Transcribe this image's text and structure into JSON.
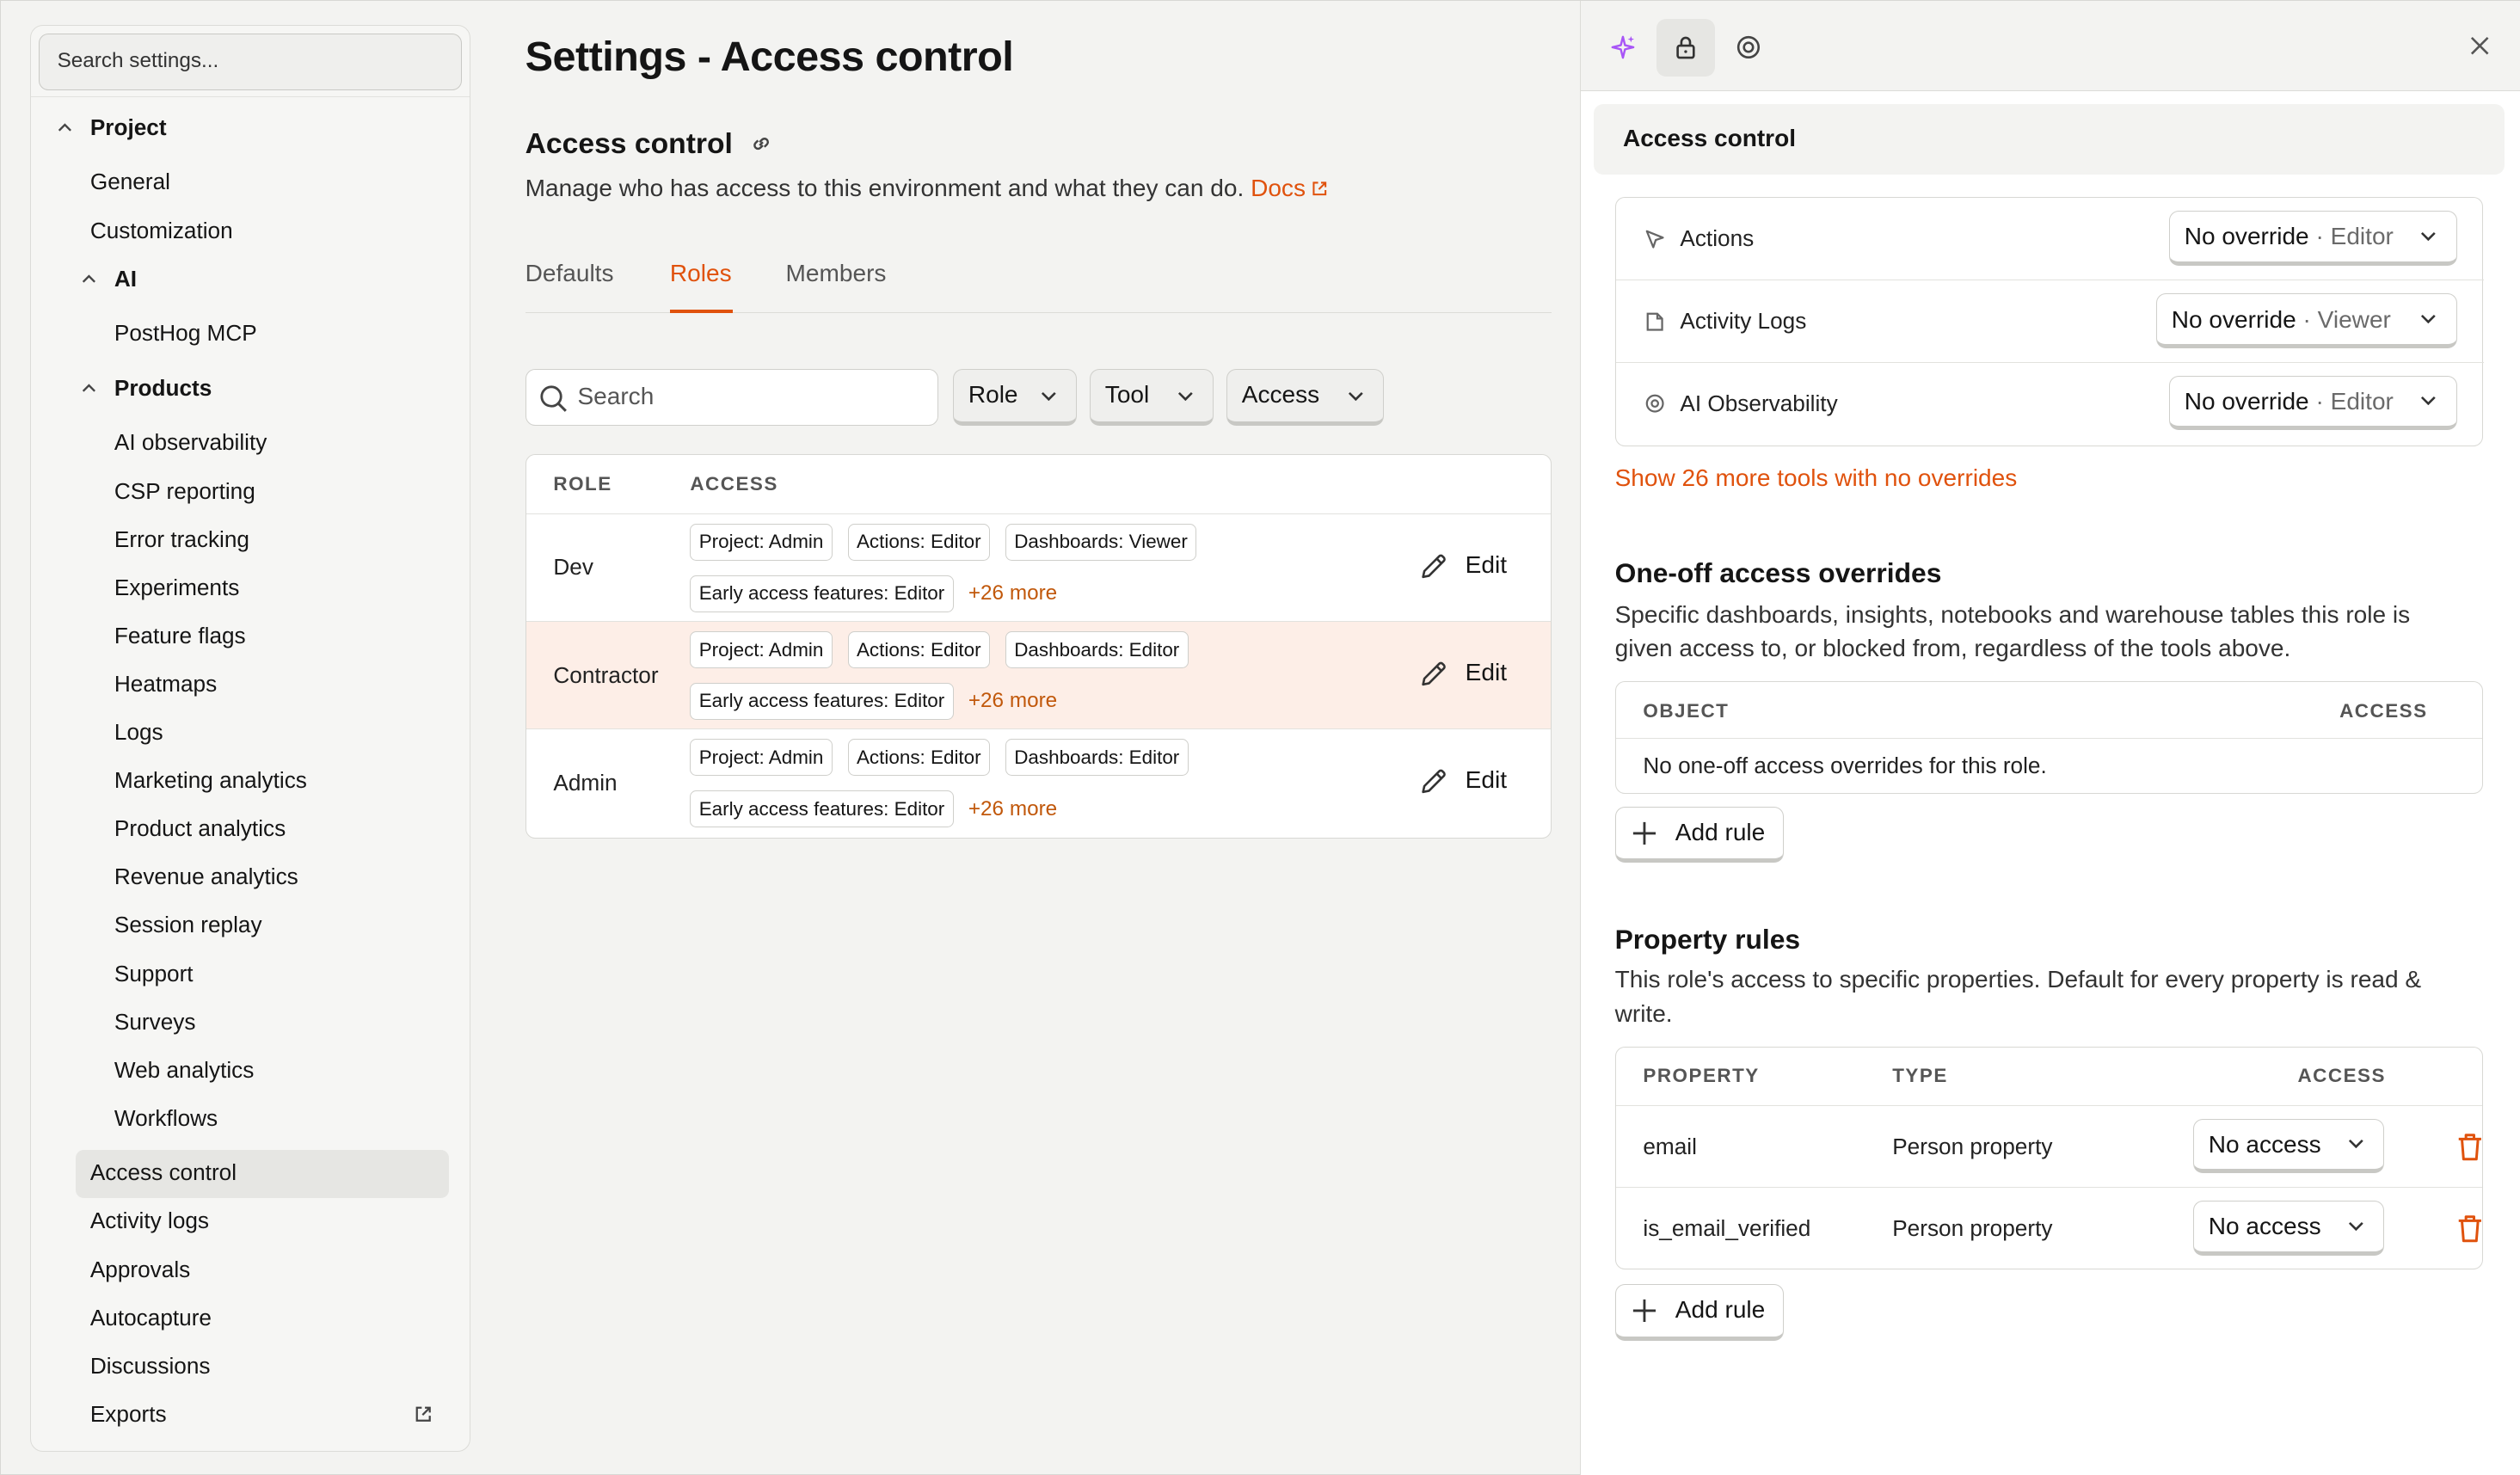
{
  "sidebar": {
    "search_placeholder": "Search settings...",
    "project_label": "Project",
    "items_top": [
      "General",
      "Customization"
    ],
    "ai_label": "AI",
    "ai_items": [
      "PostHog MCP"
    ],
    "products_label": "Products",
    "products": [
      "AI observability",
      "CSP reporting",
      "Error tracking",
      "Experiments",
      "Feature flags",
      "Heatmaps",
      "Logs",
      "Marketing analytics",
      "Product analytics",
      "Revenue analytics",
      "Session replay",
      "Support",
      "Surveys",
      "Web analytics",
      "Workflows"
    ],
    "items_bottom": [
      "Access control",
      "Activity logs",
      "Approvals",
      "Autocapture",
      "Discussions",
      "Exports"
    ]
  },
  "main": {
    "title": "Settings - Access control",
    "section_title": "Access control",
    "description": "Manage who has access to this environment and what they can do.",
    "docs_label": "Docs",
    "tabs": [
      "Defaults",
      "Roles",
      "Members"
    ],
    "search_placeholder": "Search",
    "filters": [
      "Role",
      "Tool",
      "Access"
    ],
    "table_headers": [
      "ROLE",
      "ACCESS"
    ],
    "edit_label": "Edit",
    "rows": [
      {
        "role": "Dev",
        "chips": [
          "Project: Admin",
          "Actions: Editor",
          "Dashboards: Viewer",
          "Early access features: Editor"
        ],
        "more": "+26 more"
      },
      {
        "role": "Contractor",
        "chips": [
          "Project: Admin",
          "Actions: Editor",
          "Dashboards: Editor",
          "Early access features: Editor"
        ],
        "more": "+26 more"
      },
      {
        "role": "Admin",
        "chips": [
          "Project: Admin",
          "Actions: Editor",
          "Dashboards: Editor",
          "Early access features: Editor"
        ],
        "more": "+26 more"
      }
    ]
  },
  "panel": {
    "header": "Access control",
    "tools": [
      {
        "name": "Actions",
        "override": "No override",
        "level": "Editor"
      },
      {
        "name": "Activity Logs",
        "override": "No override",
        "level": "Viewer"
      },
      {
        "name": "AI Observability",
        "override": "No override",
        "level": "Editor"
      }
    ],
    "level_separator": "·",
    "show_more": "Show 26 more tools with no overrides",
    "oneoff_title": "One-off access overrides",
    "oneoff_desc": "Specific dashboards, insights, notebooks and warehouse tables this role is given access to, or blocked from, regardless of the tools above.",
    "oneoff_headers": [
      "OBJECT",
      "ACCESS"
    ],
    "oneoff_empty": "No one-off access overrides for this role.",
    "add_rule": "Add rule",
    "prop_title": "Property rules",
    "prop_desc": "This role's access to specific properties. Default for every property is read & write.",
    "prop_headers": [
      "PROPERTY",
      "TYPE",
      "ACCESS"
    ],
    "prop_rows": [
      {
        "property": "email",
        "type": "Person property",
        "access": "No access"
      },
      {
        "property": "is_email_verified",
        "type": "Person property",
        "access": "No access"
      }
    ]
  }
}
